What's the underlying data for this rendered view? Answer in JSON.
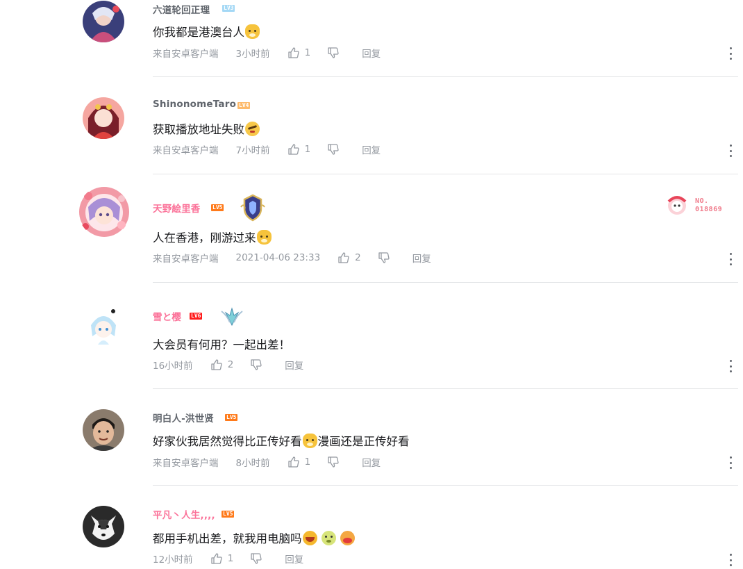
{
  "comments": [
    {
      "username": "六道轮回正理",
      "level": "LV3",
      "text": [
        "你我都是港澳台人"
      ],
      "emojis": [
        "dog"
      ],
      "source": "来自安卓客户端",
      "time": "3小时前",
      "likes": "1",
      "reply": "回复"
    },
    {
      "username": "ShinonomeTaro",
      "level": "LV4",
      "text": [
        "获取播放地址失败"
      ],
      "emojis": [
        "face"
      ],
      "source": "来自安卓客户端",
      "time": "7小时前",
      "likes": "1",
      "reply": "回复"
    },
    {
      "username": "天野絵里香",
      "level": "LV5",
      "text": [
        "人在香港，刚游过来"
      ],
      "emojis": [
        "dog"
      ],
      "source": "来自安卓客户端",
      "time": "2021-04-06 23:33",
      "likes": "2",
      "reply": "回复",
      "fan_badge_no": "NO.\n018869"
    },
    {
      "username": "雪と樱",
      "level": "LV6",
      "text": [
        "大会员有何用？一起出差！"
      ],
      "time": "16小时前",
      "likes": "2",
      "reply": "回复"
    },
    {
      "username": "明白人-洪世贤",
      "level": "LV5",
      "text": [
        "好家伙我居然觉得比正传好看",
        "漫画还是正传好看"
      ],
      "emojis": [
        "dog"
      ],
      "source": "来自安卓客户端",
      "time": "8小时前",
      "likes": "1",
      "reply": "回复"
    },
    {
      "username": "平凡丶人生,,,,",
      "level": "LV5",
      "text": [
        "都用手机出差，就我用电脑吗"
      ],
      "emojis": [
        "laugh",
        "green",
        "redface"
      ],
      "time": "12小时前",
      "likes": "1",
      "reply": "回复"
    }
  ],
  "colors": {
    "vip_name": "#fb7299",
    "name": "#61666d",
    "meta": "#9499a0",
    "divider": "#e3e5e7"
  },
  "icons": [
    "thumbs-up-icon",
    "thumbs-down-icon",
    "more-vertical-icon",
    "medal-shield-icon",
    "wing-badge-icon",
    "fan-badge-icon"
  ]
}
